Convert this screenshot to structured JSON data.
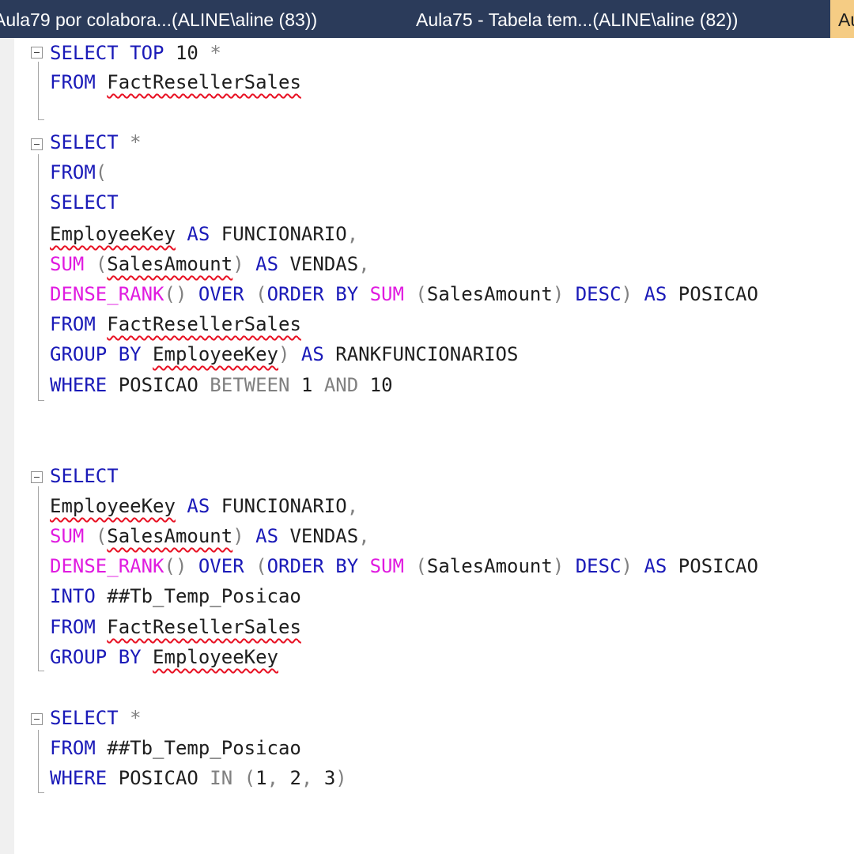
{
  "tabs": [
    {
      "label": "Aula79 por colabora...(ALINE\\aline (83))",
      "active": false
    },
    {
      "label": "Aula75 - Tabela tem...(ALINE\\aline (82))",
      "active": false
    },
    {
      "label": "Au",
      "active": true
    }
  ],
  "editor": {
    "lines": [
      [
        {
          "t": "kw",
          "v": "SELECT"
        },
        {
          "t": "str",
          "v": " "
        },
        {
          "t": "kw",
          "v": "TOP"
        },
        {
          "t": "str",
          "v": " 10 "
        },
        {
          "t": "op",
          "v": "*"
        }
      ],
      [
        {
          "t": "kw",
          "v": "FROM"
        },
        {
          "t": "str",
          "v": " "
        },
        {
          "t": "sq",
          "v": "FactResellerSales"
        }
      ],
      [],
      [
        {
          "t": "kw",
          "v": "SELECT"
        },
        {
          "t": "str",
          "v": " "
        },
        {
          "t": "op",
          "v": "*"
        }
      ],
      [
        {
          "t": "kw",
          "v": "FROM"
        },
        {
          "t": "op",
          "v": "("
        }
      ],
      [
        {
          "t": "kw",
          "v": "SELECT"
        }
      ],
      [
        {
          "t": "sq",
          "v": "EmployeeKey"
        },
        {
          "t": "str",
          "v": " "
        },
        {
          "t": "kw",
          "v": "AS"
        },
        {
          "t": "str",
          "v": " FUNCIONARIO"
        },
        {
          "t": "op",
          "v": ","
        }
      ],
      [
        {
          "t": "fn",
          "v": "SUM"
        },
        {
          "t": "str",
          "v": " "
        },
        {
          "t": "op",
          "v": "("
        },
        {
          "t": "sq",
          "v": "SalesAmount"
        },
        {
          "t": "op",
          "v": ")"
        },
        {
          "t": "str",
          "v": " "
        },
        {
          "t": "kw",
          "v": "AS"
        },
        {
          "t": "str",
          "v": " VENDAS"
        },
        {
          "t": "op",
          "v": ","
        }
      ],
      [
        {
          "t": "fn",
          "v": "DENSE_RANK"
        },
        {
          "t": "op",
          "v": "()"
        },
        {
          "t": "str",
          "v": " "
        },
        {
          "t": "kw",
          "v": "OVER"
        },
        {
          "t": "str",
          "v": " "
        },
        {
          "t": "op",
          "v": "("
        },
        {
          "t": "kw",
          "v": "ORDER BY"
        },
        {
          "t": "str",
          "v": " "
        },
        {
          "t": "fn",
          "v": "SUM"
        },
        {
          "t": "str",
          "v": " "
        },
        {
          "t": "op",
          "v": "("
        },
        {
          "t": "str",
          "v": "SalesAmount"
        },
        {
          "t": "op",
          "v": ")"
        },
        {
          "t": "str",
          "v": " "
        },
        {
          "t": "kw",
          "v": "DESC"
        },
        {
          "t": "op",
          "v": ")"
        },
        {
          "t": "str",
          "v": " "
        },
        {
          "t": "kw",
          "v": "AS"
        },
        {
          "t": "str",
          "v": " POSICAO"
        }
      ],
      [
        {
          "t": "kw",
          "v": "FROM"
        },
        {
          "t": "str",
          "v": " "
        },
        {
          "t": "sq",
          "v": "FactResellerSales"
        }
      ],
      [
        {
          "t": "kw",
          "v": "GROUP BY"
        },
        {
          "t": "str",
          "v": " "
        },
        {
          "t": "sq",
          "v": "EmployeeKey"
        },
        {
          "t": "op",
          "v": ")"
        },
        {
          "t": "str",
          "v": " "
        },
        {
          "t": "kw",
          "v": "AS"
        },
        {
          "t": "str",
          "v": " RANKFUNCIONARIOS"
        }
      ],
      [
        {
          "t": "kw",
          "v": "WHERE"
        },
        {
          "t": "str",
          "v": " POSICAO "
        },
        {
          "t": "op",
          "v": "BETWEEN"
        },
        {
          "t": "str",
          "v": " 1 "
        },
        {
          "t": "op",
          "v": "AND"
        },
        {
          "t": "str",
          "v": " 10"
        }
      ],
      [],
      [],
      [
        {
          "t": "kw",
          "v": "SELECT"
        }
      ],
      [
        {
          "t": "sq",
          "v": "EmployeeKey"
        },
        {
          "t": "str",
          "v": " "
        },
        {
          "t": "kw",
          "v": "AS"
        },
        {
          "t": "str",
          "v": " FUNCIONARIO"
        },
        {
          "t": "op",
          "v": ","
        }
      ],
      [
        {
          "t": "fn",
          "v": "SUM"
        },
        {
          "t": "str",
          "v": " "
        },
        {
          "t": "op",
          "v": "("
        },
        {
          "t": "sq",
          "v": "SalesAmount"
        },
        {
          "t": "op",
          "v": ")"
        },
        {
          "t": "str",
          "v": " "
        },
        {
          "t": "kw",
          "v": "AS"
        },
        {
          "t": "str",
          "v": " VENDAS"
        },
        {
          "t": "op",
          "v": ","
        }
      ],
      [
        {
          "t": "fn",
          "v": "DENSE_RANK"
        },
        {
          "t": "op",
          "v": "()"
        },
        {
          "t": "str",
          "v": " "
        },
        {
          "t": "kw",
          "v": "OVER"
        },
        {
          "t": "str",
          "v": " "
        },
        {
          "t": "op",
          "v": "("
        },
        {
          "t": "kw",
          "v": "ORDER BY"
        },
        {
          "t": "str",
          "v": " "
        },
        {
          "t": "fn",
          "v": "SUM"
        },
        {
          "t": "str",
          "v": " "
        },
        {
          "t": "op",
          "v": "("
        },
        {
          "t": "str",
          "v": "SalesAmount"
        },
        {
          "t": "op",
          "v": ")"
        },
        {
          "t": "str",
          "v": " "
        },
        {
          "t": "kw",
          "v": "DESC"
        },
        {
          "t": "op",
          "v": ")"
        },
        {
          "t": "str",
          "v": " "
        },
        {
          "t": "kw",
          "v": "AS"
        },
        {
          "t": "str",
          "v": " POSICAO"
        }
      ],
      [
        {
          "t": "kw",
          "v": "INTO"
        },
        {
          "t": "str",
          "v": " ##Tb_Temp_Posicao"
        }
      ],
      [
        {
          "t": "kw",
          "v": "FROM"
        },
        {
          "t": "str",
          "v": " "
        },
        {
          "t": "sq",
          "v": "FactResellerSales"
        }
      ],
      [
        {
          "t": "kw",
          "v": "GROUP BY"
        },
        {
          "t": "str",
          "v": " "
        },
        {
          "t": "sq",
          "v": "EmployeeKey"
        }
      ],
      [],
      [
        {
          "t": "kw",
          "v": "SELECT"
        },
        {
          "t": "str",
          "v": " "
        },
        {
          "t": "op",
          "v": "*"
        }
      ],
      [
        {
          "t": "kw",
          "v": "FROM"
        },
        {
          "t": "str",
          "v": " ##Tb_Temp_Posicao"
        }
      ],
      [
        {
          "t": "kw",
          "v": "WHERE"
        },
        {
          "t": "str",
          "v": " POSICAO "
        },
        {
          "t": "op",
          "v": "IN"
        },
        {
          "t": "str",
          "v": " "
        },
        {
          "t": "op",
          "v": "("
        },
        {
          "t": "str",
          "v": "1"
        },
        {
          "t": "op",
          "v": ","
        },
        {
          "t": "str",
          "v": " 2"
        },
        {
          "t": "op",
          "v": ","
        },
        {
          "t": "str",
          "v": " 3"
        },
        {
          "t": "op",
          "v": ")"
        }
      ]
    ]
  },
  "colors": {
    "tabbar_bg": "#2b3b5a",
    "active_tab_bg": "#f5cc84",
    "keyword": "#1a1ab8",
    "function": "#e01be0",
    "operator": "#808080",
    "text": "#1e1e1e",
    "squiggle": "#e81123"
  }
}
